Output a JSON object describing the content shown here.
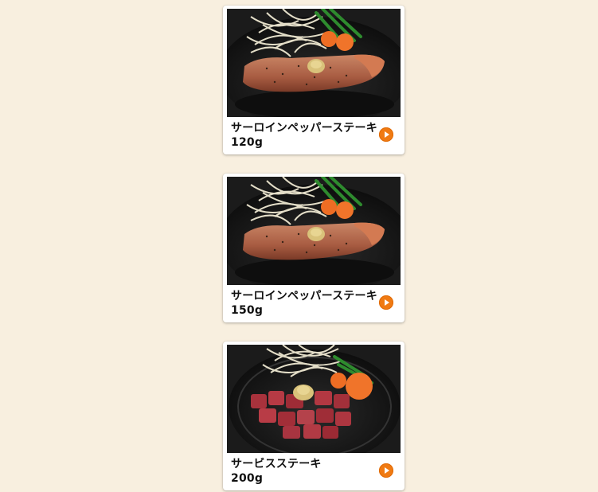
{
  "menu": {
    "items": [
      {
        "name": "サーロインペッパーステーキ",
        "weight": "120g",
        "image_desc": "sirloin-steak-photo"
      },
      {
        "name": "サーロインペッパーステーキ",
        "weight": "150g",
        "image_desc": "sirloin-steak-photo"
      },
      {
        "name": "サービスステーキ",
        "weight": "200g",
        "image_desc": "cubed-steak-photo"
      }
    ],
    "arrow_icon": "chevron-right-circle-icon"
  },
  "colors": {
    "background": "#f8efdf",
    "card": "#ffffff",
    "accent": "#f07a12"
  }
}
